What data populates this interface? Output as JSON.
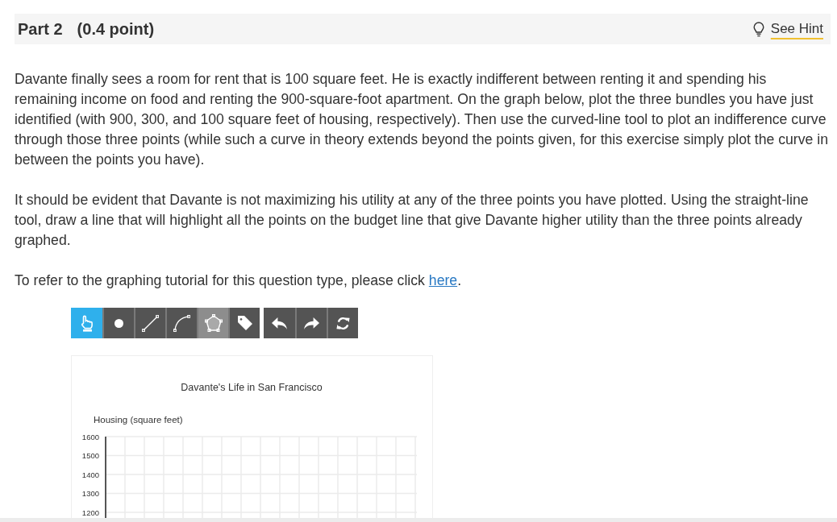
{
  "header": {
    "title": "Part 2",
    "points": "(0.4 point)",
    "hint_link": "See Hint"
  },
  "paragraphs": [
    "Davante finally sees a room for rent that is 100 square feet. He is exactly indifferent between renting it and spending his remaining income on food and renting the 900-square-foot apartment. On the graph below, plot the three bundles you have just identified (with 900, 300, and 100 square feet of housing, respectively). Then use the curved-line tool to plot an indifference curve through those three points (while such a curve in theory extends beyond the points given, for this exercise simply plot the curve in between the points you have).",
    "It should be evident that Davante is not maximizing his utility at any of the three points you have plotted. Using the straight-line tool, draw a line that will highlight all the points on the budget line that give Davante higher utility than the three points already graphed."
  ],
  "tutorial_note": {
    "text": "To refer to the graphing tutorial for this question type, please click",
    "link": "here",
    "end": "."
  },
  "toolbar": {
    "tools": [
      {
        "selected": true,
        "highlighted": false
      },
      {
        "selected": false,
        "highlighted": false
      },
      {
        "selected": false,
        "highlighted": false
      },
      {
        "selected": false,
        "highlighted": false
      },
      {
        "selected": false,
        "highlighted": true
      },
      {
        "selected": false,
        "highlighted": false
      }
    ]
  },
  "graph": {
    "title": "Davante's Life in San Francisco",
    "y_axis_label": "Housing (square feet)",
    "y_tick_labels": [
      "1600",
      "1500",
      "1400",
      "1300",
      "1200"
    ]
  }
}
